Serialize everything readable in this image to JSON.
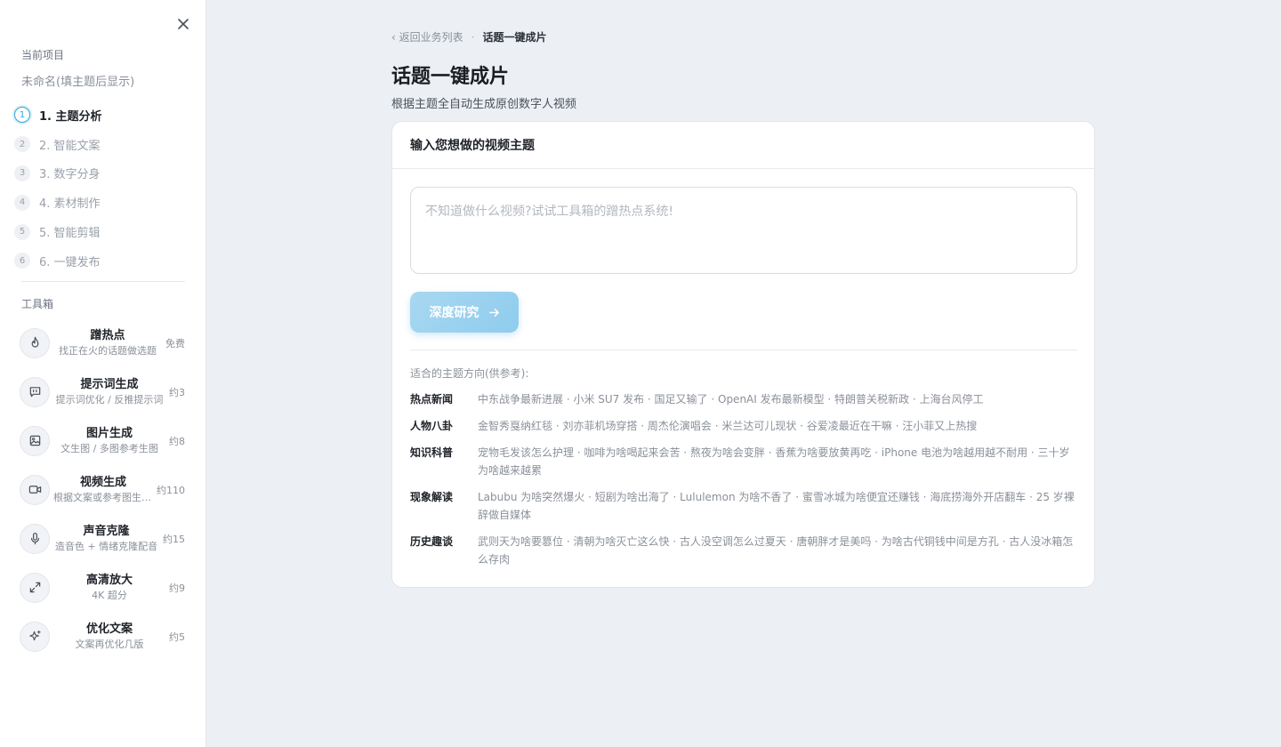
{
  "sidebar": {
    "current_project_label": "当前项目",
    "project_name": "未命名(填主题后显示)",
    "steps": [
      {
        "num": "1",
        "label": "1. 主题分析",
        "active": true
      },
      {
        "num": "2",
        "label": "2. 智能文案",
        "active": false
      },
      {
        "num": "3",
        "label": "3. 数字分身",
        "active": false
      },
      {
        "num": "4",
        "label": "4. 素材制作",
        "active": false
      },
      {
        "num": "5",
        "label": "5. 智能剪辑",
        "active": false
      },
      {
        "num": "6",
        "label": "6. 一键发布",
        "active": false
      }
    ],
    "toolbox_label": "工具箱",
    "tools": [
      {
        "icon": "flame-icon",
        "title": "蹭热点",
        "subtitle": "找正在火的话题做选题",
        "cost": "免费"
      },
      {
        "icon": "chat-quote-icon",
        "title": "提示词生成",
        "subtitle": "提示词优化 / 反推提示词",
        "cost": "约3"
      },
      {
        "icon": "image-icon",
        "title": "图片生成",
        "subtitle": "文生图 / 多图参考生图",
        "cost": "约8"
      },
      {
        "icon": "video-camera-icon",
        "title": "视频生成",
        "subtitle": "根据文案或参考图生成视频",
        "cost": "约110"
      },
      {
        "icon": "microphone-icon",
        "title": "声音克隆",
        "subtitle": "造音色 + 情绪克隆配音",
        "cost": "约15"
      },
      {
        "icon": "expand-arrows-icon",
        "title": "高清放大",
        "subtitle": "4K 超分",
        "cost": "约9"
      },
      {
        "icon": "sparkles-icon",
        "title": "优化文案",
        "subtitle": "文案再优化几版",
        "cost": "约5"
      }
    ]
  },
  "breadcrumb": {
    "back": "‹ 返回业务列表",
    "separator": "·",
    "current": "话题一键成片"
  },
  "page": {
    "title": "话题一键成片",
    "subtitle": "根据主题全自动生成原创数字人视频"
  },
  "card": {
    "header": "输入您想做的视频主题",
    "input_value": "",
    "input_placeholder": "不知道做什么视频?试试工具箱的蹭热点系统!",
    "button_label": "深度研究",
    "suggestions_label": "适合的主题方向(供参考):",
    "categories": [
      {
        "name": "热点新闻",
        "items": "中东战争最新进展 · 小米 SU7 发布 · 国足又输了 · OpenAI 发布最新模型 · 特朗普关税新政 · 上海台风停工"
      },
      {
        "name": "人物八卦",
        "items": "金智秀戛纳红毯 · 刘亦菲机场穿搭 · 周杰伦演唱会 · 米兰达可儿现状 · 谷爱凌最近在干嘛 · 汪小菲又上热搜"
      },
      {
        "name": "知识科普",
        "items": "宠物毛发该怎么护理 · 咖啡为啥喝起来会苦 · 熬夜为啥会变胖 · 香蕉为啥要放黄再吃 · iPhone 电池为啥越用越不耐用 · 三十岁为啥越来越累"
      },
      {
        "name": "现象解读",
        "items": "Labubu 为啥突然爆火 · 短剧为啥出海了 · Lululemon 为啥不香了 · 蜜雪冰城为啥便宜还赚钱 · 海底捞海外开店翻车 · 25 岁裸辞做自媒体"
      },
      {
        "name": "历史趣谈",
        "items": "武则天为啥要篡位 · 清朝为啥灭亡这么快 · 古人没空调怎么过夏天 · 唐朝胖才是美吗 · 为啥古代铜钱中间是方孔 · 古人没冰箱怎么存肉"
      }
    ]
  },
  "colors": {
    "accent": "#2ea7dc",
    "button_bg": "#9dd3f0",
    "page_bg": "#eceff4"
  }
}
